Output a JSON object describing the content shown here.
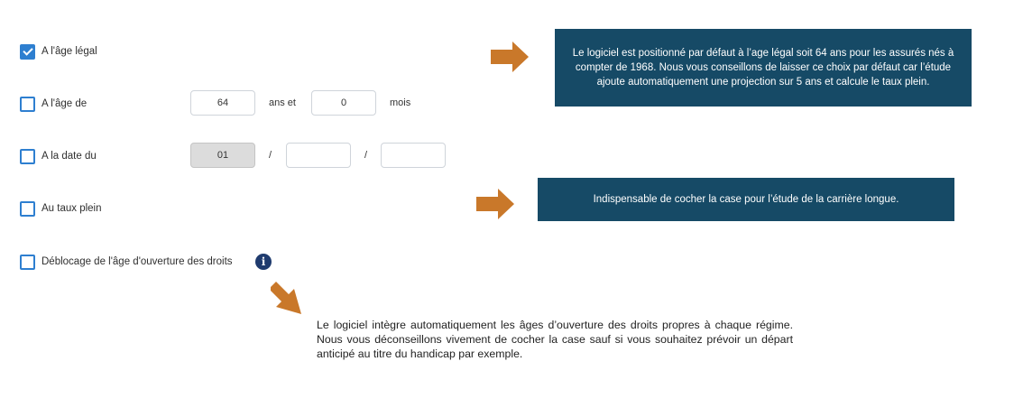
{
  "options": [
    {
      "label": "A l'âge légal",
      "checked": true
    },
    {
      "label": "A l'âge de",
      "checked": false
    },
    {
      "label": "A la date du",
      "checked": false
    },
    {
      "label": "Au taux plein",
      "checked": false
    },
    {
      "label": "Déblocage de l'âge d'ouverture des droits",
      "checked": false
    }
  ],
  "age_fields": {
    "years_value": "64",
    "years_unit": "ans et",
    "months_value": "0",
    "months_unit": "mois"
  },
  "date_fields": {
    "day_value": "01",
    "separator": "/",
    "month_value": "",
    "year_value": ""
  },
  "info_icon": "info-circle-icon",
  "arrow_color": "#c9782a",
  "tooltip_color": "#164a66",
  "tooltips": {
    "legal_age": "Le logiciel est positionné par défaut à l’age légal soit 64 ans pour les assurés nés à compter de 1968. Nous vous conseillons de laisser ce choix par défaut car l’étude ajoute automatiquement une projection sur 5 ans et calcule le taux plein.",
    "full_rate": "Indispensable de cocher la case pour l’étude de la carrière longue."
  },
  "note": "Le logiciel intègre automatiquement les âges d’ouverture des droits propres à chaque régime. Nous vous déconseillons vivement de cocher la case sauf si vous souhaitez prévoir un départ anticipé au titre du handicap par exemple."
}
